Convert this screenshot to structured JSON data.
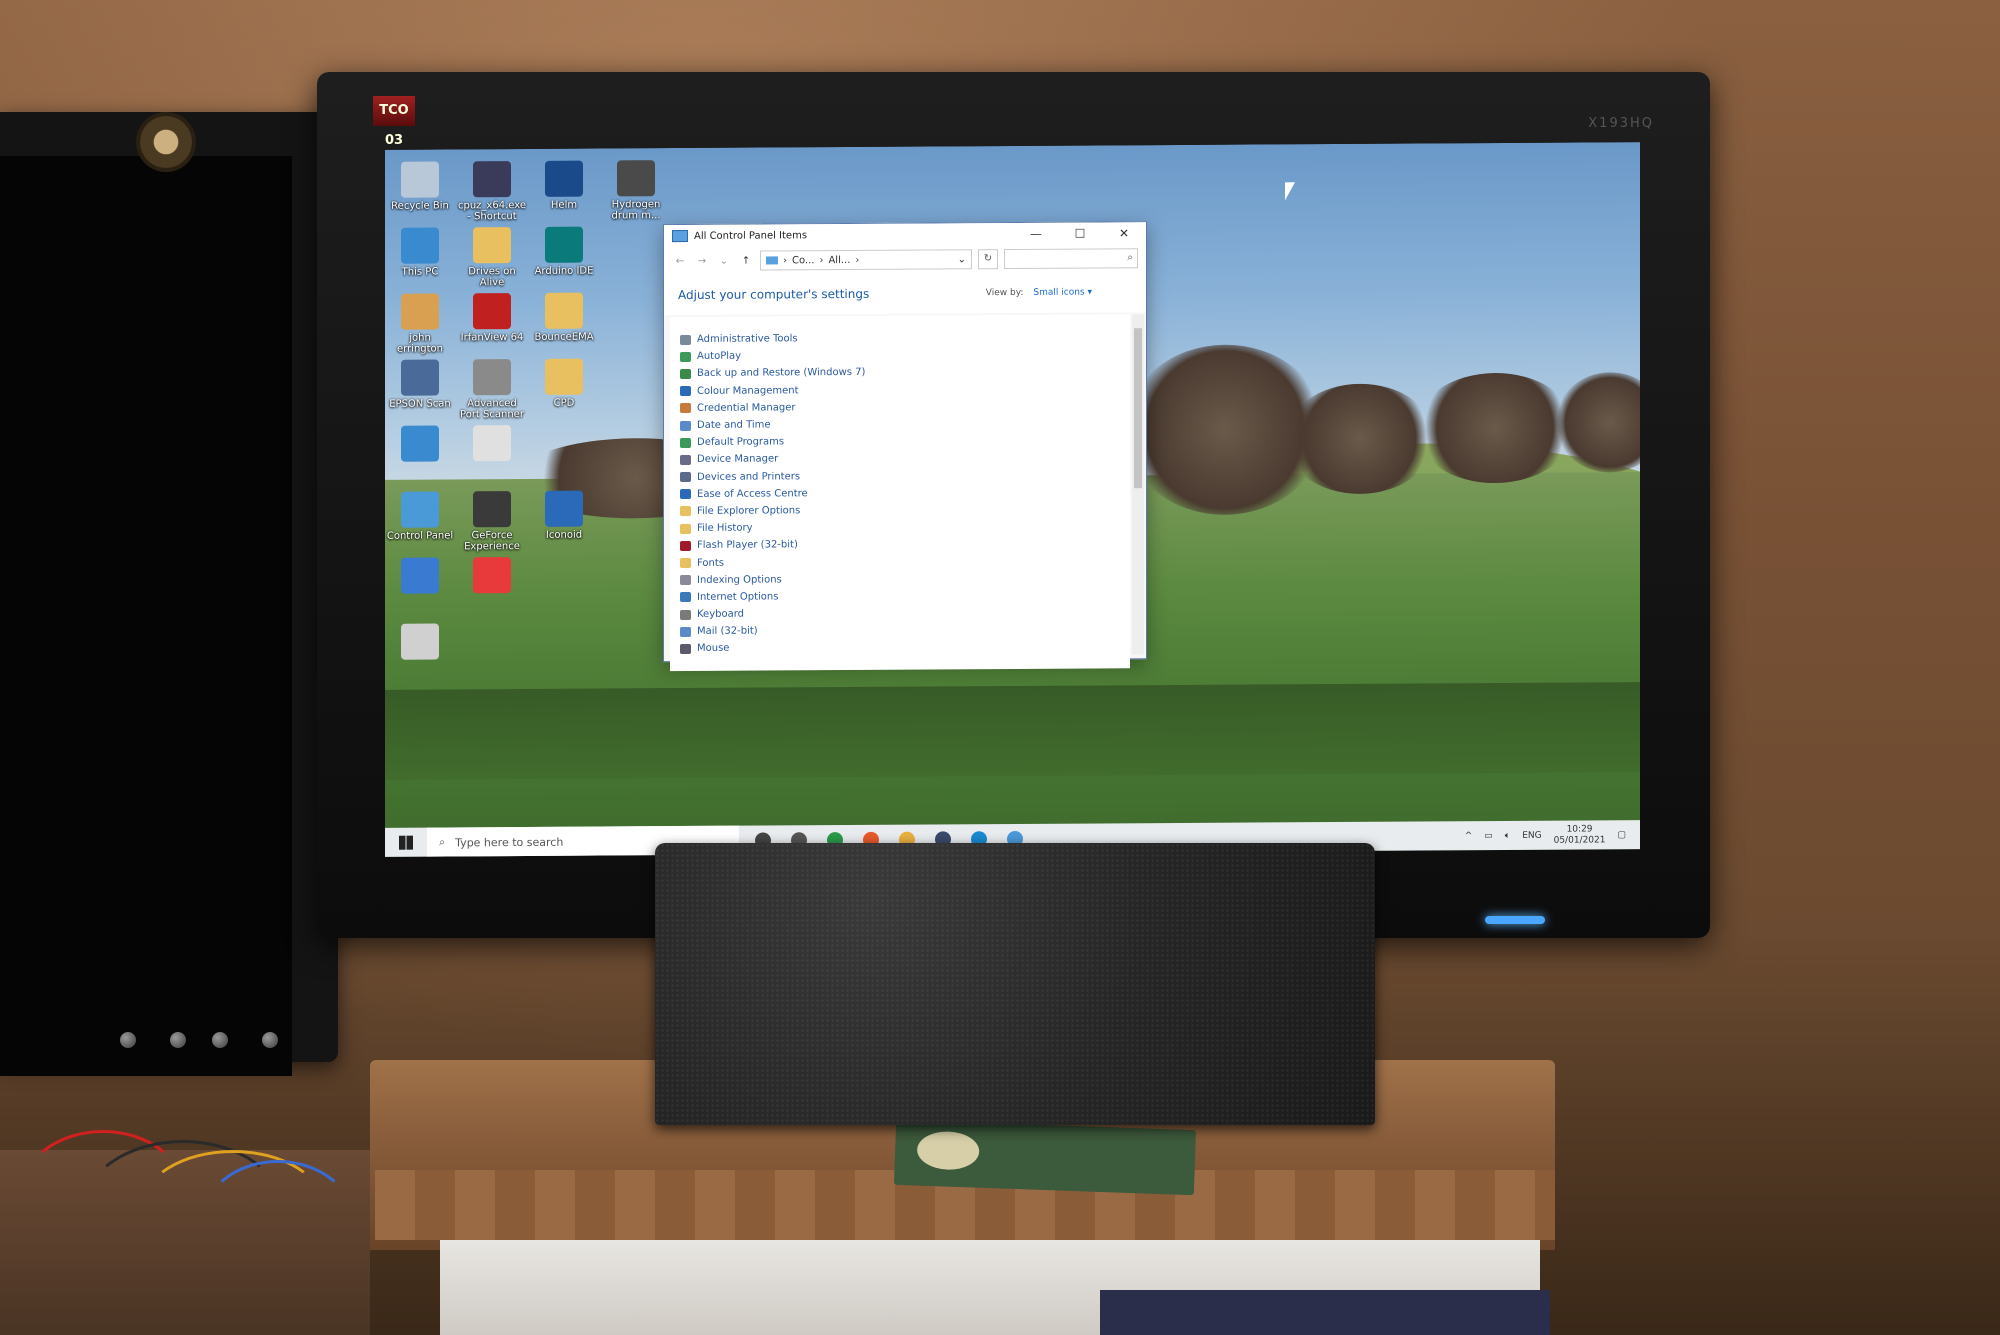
{
  "monitor": {
    "badge": "TCO 03",
    "model": "X193HQ"
  },
  "desktop_icons": [
    {
      "label": "Recycle Bin",
      "icon": "recycle-bin-icon",
      "color": "#b8c8d8"
    },
    {
      "label": "cpuz_x64.exe - Shortcut",
      "icon": "cpuz-icon",
      "color": "#3a3a5a"
    },
    {
      "label": "Helm",
      "icon": "helm-icon",
      "color": "#1a4a8a"
    },
    {
      "label": "Hydrogen drum m...",
      "icon": "hydrogen-icon",
      "color": "#4a4a4a"
    },
    {
      "label": "This PC",
      "icon": "this-pc-icon",
      "color": "#3a8ad0"
    },
    {
      "label": "Drives on Alive",
      "icon": "folder-icon",
      "color": "#e8c060"
    },
    {
      "label": "Arduino IDE",
      "icon": "arduino-icon",
      "color": "#0a7a7a"
    },
    {
      "label": "john errington",
      "icon": "user-folder-icon",
      "color": "#d8a050"
    },
    {
      "label": "IrfanView 64",
      "icon": "irfanview-icon",
      "color": "#c02020"
    },
    {
      "label": "BounceEMA",
      "icon": "folder-icon",
      "color": "#e8c060"
    },
    {
      "label": "EPSON Scan",
      "icon": "epson-scan-icon",
      "color": "#4a6a9a"
    },
    {
      "label": "Advanced Port Scanner",
      "icon": "port-scanner-icon",
      "color": "#8a8a8a"
    },
    {
      "label": "CPD",
      "icon": "folder-icon",
      "color": "#e8c060"
    },
    {
      "label": "",
      "icon": "network-icon",
      "color": "#3a8ad0"
    },
    {
      "label": "",
      "icon": "document-icon",
      "color": "#e0e0e0"
    },
    {
      "label": "Control Panel",
      "icon": "control-panel-icon",
      "color": "#4a9ad8"
    },
    {
      "label": "GeForce Experience",
      "icon": "geforce-icon",
      "color": "#3a3a3a"
    },
    {
      "label": "Iconoid",
      "icon": "iconoid-icon",
      "color": "#2a6ab8"
    },
    {
      "label": "",
      "icon": "paint-net-icon",
      "color": "#3a7ad0"
    },
    {
      "label": "",
      "icon": "anydesk-icon",
      "color": "#e83a3a"
    },
    {
      "label": "",
      "icon": "drive-icon",
      "color": "#d0d0d0"
    }
  ],
  "window": {
    "title": "All Control Panel Items",
    "minimize": "—",
    "maximize": "☐",
    "close": "✕",
    "breadcrumb": [
      "Co...",
      "All..."
    ],
    "heading": "Adjust your computer's settings",
    "view_by_label": "View by:",
    "view_by_value": "Small icons ▾",
    "items": [
      {
        "label": "Administrative Tools",
        "color": "#7a8a9a"
      },
      {
        "label": "AutoPlay",
        "color": "#3a9a5a"
      },
      {
        "label": "Back up and Restore (Windows 7)",
        "color": "#3a8a4a"
      },
      {
        "label": "Colour Management",
        "color": "#2a6ab8"
      },
      {
        "label": "Credential Manager",
        "color": "#c87a3a"
      },
      {
        "label": "Date and Time",
        "color": "#5a8ac8"
      },
      {
        "label": "Default Programs",
        "color": "#3a9a5a"
      },
      {
        "label": "Device Manager",
        "color": "#6a6a8a"
      },
      {
        "label": "Devices and Printers",
        "color": "#5a6a8a"
      },
      {
        "label": "Ease of Access Centre",
        "color": "#2a6ab8"
      },
      {
        "label": "File Explorer Options",
        "color": "#e8c060"
      },
      {
        "label": "File History",
        "color": "#e8c060"
      },
      {
        "label": "Flash Player (32-bit)",
        "color": "#a01a2a"
      },
      {
        "label": "Fonts",
        "color": "#e8c060"
      },
      {
        "label": "Indexing Options",
        "color": "#8a8a9a"
      },
      {
        "label": "Internet Options",
        "color": "#3a7ab8"
      },
      {
        "label": "Keyboard",
        "color": "#7a7a7a"
      },
      {
        "label": "Mail (32-bit)",
        "color": "#5a8ac8"
      },
      {
        "label": "Mouse",
        "color": "#5a5a6a"
      }
    ]
  },
  "taskbar": {
    "search_placeholder": "Type here to search",
    "apps": [
      {
        "icon": "cortana-icon",
        "color": "#444444"
      },
      {
        "icon": "task-view-icon",
        "color": "#555555"
      },
      {
        "icon": "chrome-icon",
        "color": "#2a9a4a"
      },
      {
        "icon": "firefox-icon",
        "color": "#e85a2a"
      },
      {
        "icon": "file-explorer-icon",
        "color": "#e8b040"
      },
      {
        "icon": "steam-icon",
        "color": "#3a4a6a"
      },
      {
        "icon": "edge-icon",
        "color": "#1a8ad0"
      },
      {
        "icon": "control-panel-icon",
        "color": "#4a9ad8"
      }
    ],
    "language": "ENG",
    "time": "10:29",
    "date": "05/01/2021"
  }
}
